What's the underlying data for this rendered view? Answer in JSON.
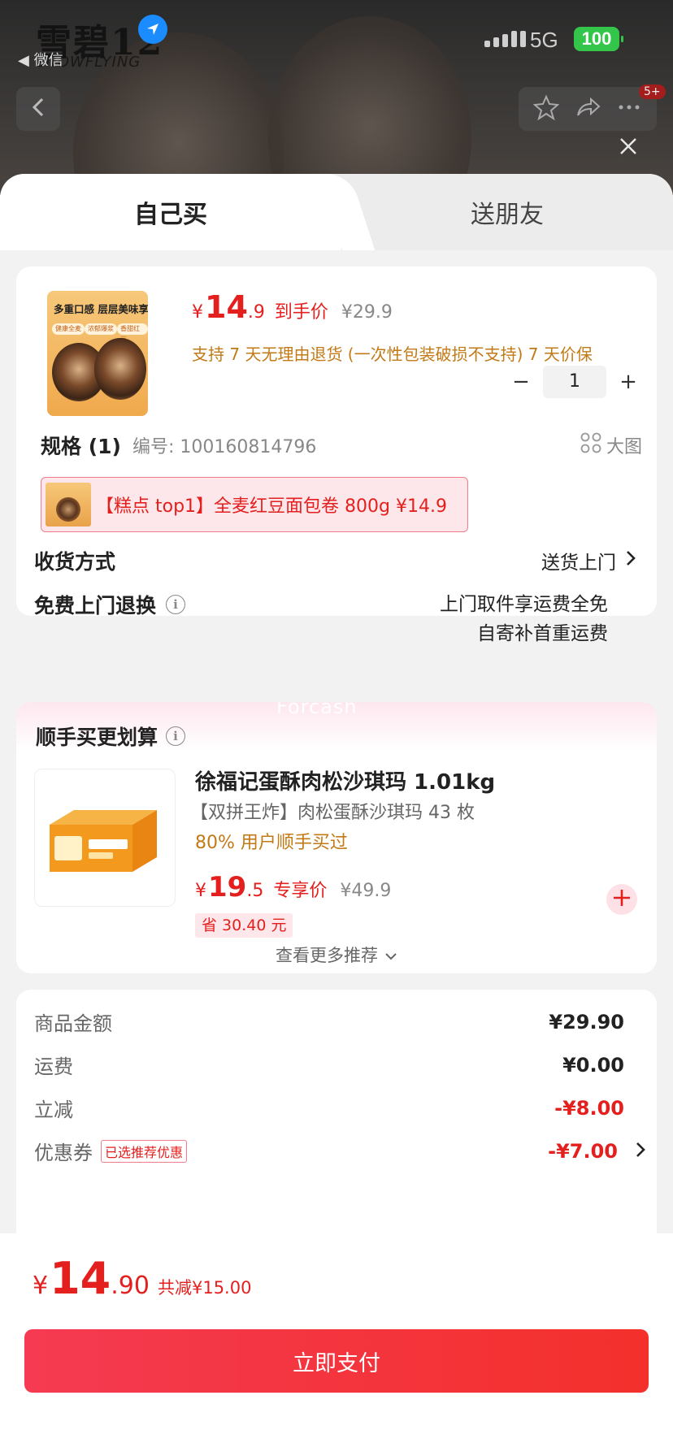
{
  "status_bar": {
    "brand": "雪碧12",
    "brand_sub": "SNOWFLYING",
    "back_app": "◀ 微信",
    "network": "5G",
    "battery": "100",
    "nav_badge": "5+"
  },
  "tabs": [
    {
      "label": "自己买",
      "active": true
    },
    {
      "label": "送朋友",
      "active": false
    }
  ],
  "product": {
    "image_caption": "多重口感 层层美味享不停",
    "image_tags": [
      "健康全麦",
      "浓郁爆浆",
      "香甜红豆"
    ],
    "currency": "¥",
    "price_int": "14",
    "price_dec": ".9",
    "price_label": "到手价",
    "original_price": "¥29.9",
    "policy": "支持 7 天无理由退货 (一次性包装破损不支持)  7 天价保",
    "quantity": "1",
    "qty_minus": "−",
    "qty_plus": "+"
  },
  "spec": {
    "title": "规格 (1)",
    "code": "编号: 100160814796",
    "big_image": "大图",
    "selected_option": "【糕点 top1】全麦红豆面包卷 800g  ¥14.9"
  },
  "delivery": {
    "label": "收货方式",
    "value": "送货上门"
  },
  "returns": {
    "label": "免费上门退换",
    "line1": "上门取件享运费全免",
    "line2": "自寄补首重运费"
  },
  "addon": {
    "watermark": "Forcash",
    "heading": "顺手买更划算",
    "title": "徐福记蛋酥肉松沙琪玛 1.01kg",
    "subtitle": "【双拼王炸】肉松蛋酥沙琪玛 43 枚",
    "social_proof": "80% 用户顺手买过",
    "currency": "¥",
    "price_int": "19",
    "price_dec": ".5",
    "price_label": "专享价",
    "original_price": "¥49.9",
    "save": "省 30.40 元",
    "more": "查看更多推荐"
  },
  "summary": [
    {
      "label": "商品金额",
      "value": "¥29.90",
      "red": false
    },
    {
      "label": "运费",
      "value": "¥0.00",
      "red": false
    },
    {
      "label": "立减",
      "value": "-¥8.00",
      "red": true
    },
    {
      "label": "优惠券",
      "tag": "已选推荐优惠",
      "value": "-¥7.00",
      "red": true
    }
  ],
  "footer": {
    "currency": "¥",
    "total_int": "14",
    "total_dec": ".90",
    "discount": "共减¥15.00",
    "pay_label": "立即支付"
  },
  "colors": {
    "accent_red": "#e4201f",
    "policy_orange": "#c27a16",
    "battery_green": "#33c64a",
    "location_blue": "#1a8cff"
  }
}
